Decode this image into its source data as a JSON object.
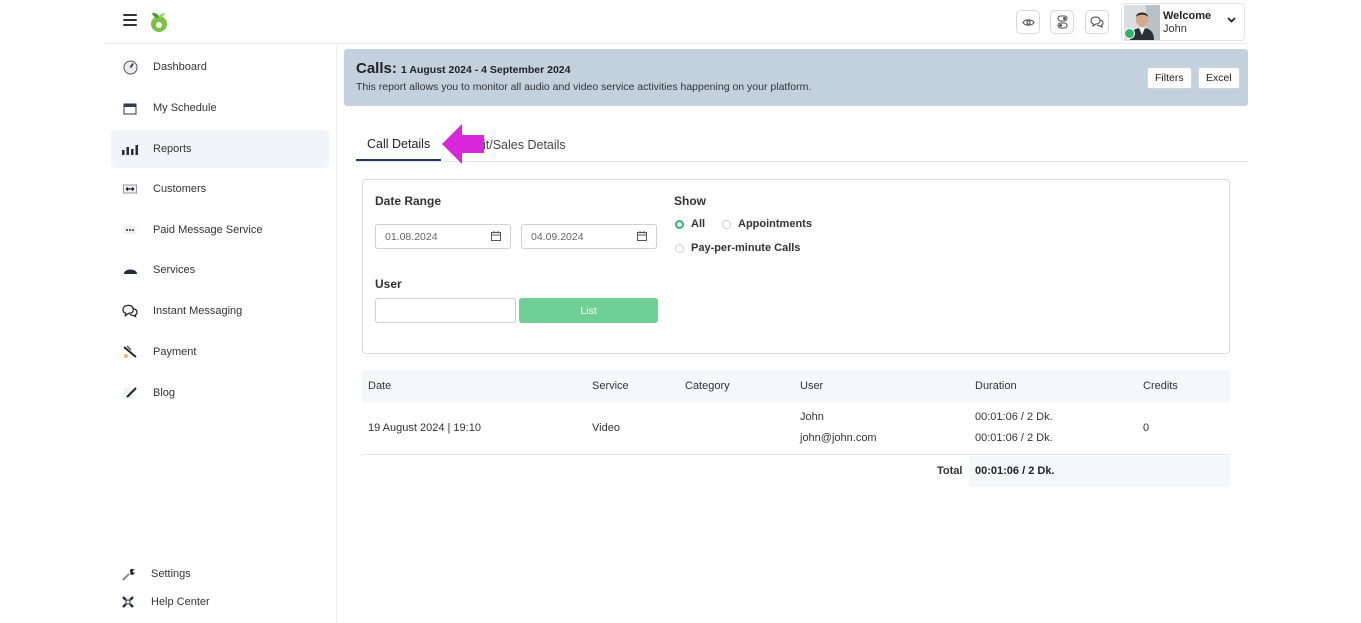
{
  "header": {
    "welcome": "Welcome",
    "user_name": "John"
  },
  "sidebar": {
    "items": [
      {
        "label": "Dashboard",
        "icon": "gauge-icon"
      },
      {
        "label": "My Schedule",
        "icon": "calendar-icon"
      },
      {
        "label": "Reports",
        "icon": "bar-chart-icon"
      },
      {
        "label": "Customers",
        "icon": "customers-icon"
      },
      {
        "label": "Paid Message Service",
        "icon": "message-dots-icon"
      },
      {
        "label": "Services",
        "icon": "cloche-icon"
      },
      {
        "label": "Instant Messaging",
        "icon": "chat-bubbles-icon"
      },
      {
        "label": "Payment",
        "icon": "payment-icon"
      },
      {
        "label": "Blog",
        "icon": "pen-icon"
      }
    ],
    "footer": [
      {
        "label": "Settings",
        "icon": "wrench-icon"
      },
      {
        "label": "Help Center",
        "icon": "help-icon"
      }
    ]
  },
  "banner": {
    "title": "Calls:",
    "date_range": "1 August 2024 - 4 September 2024",
    "description": "This report allows you to monitor all audio and video service activities happening on your platform.",
    "filters_label": "Filters",
    "excel_label": "Excel"
  },
  "tabs": [
    {
      "label": "Call Details",
      "active": true
    },
    {
      "label": "it/Sales Details",
      "active": false
    }
  ],
  "filters": {
    "date_range_label": "Date Range",
    "date_from": "01.08.2024",
    "date_to": "04.09.2024",
    "show_label": "Show",
    "options": [
      {
        "label": "All",
        "selected": true
      },
      {
        "label": "Appointments",
        "selected": false
      },
      {
        "label": "Pay-per-minute Calls",
        "selected": false
      }
    ],
    "user_label": "User",
    "user_value": "",
    "list_label": "List"
  },
  "table": {
    "columns": [
      "Date",
      "Service",
      "Category",
      "User",
      "Duration",
      "Credits"
    ],
    "rows": [
      {
        "date": "19 August 2024 | 19:10",
        "service": "Video",
        "category": "",
        "user_name": "John",
        "user_email": "john@john.com",
        "duration_1": "00:01:06 / 2 Dk.",
        "duration_2": "00:01:06 / 2 Dk.",
        "credits": "0"
      }
    ],
    "total_label": "Total",
    "total_value": "00:01:06 / 2 Dk."
  },
  "colors": {
    "accent_green": "#6fcf95",
    "banner_bg": "#c3d0de",
    "annotation_arrow": "#d926d9",
    "tab_underline": "#1f3a64"
  }
}
